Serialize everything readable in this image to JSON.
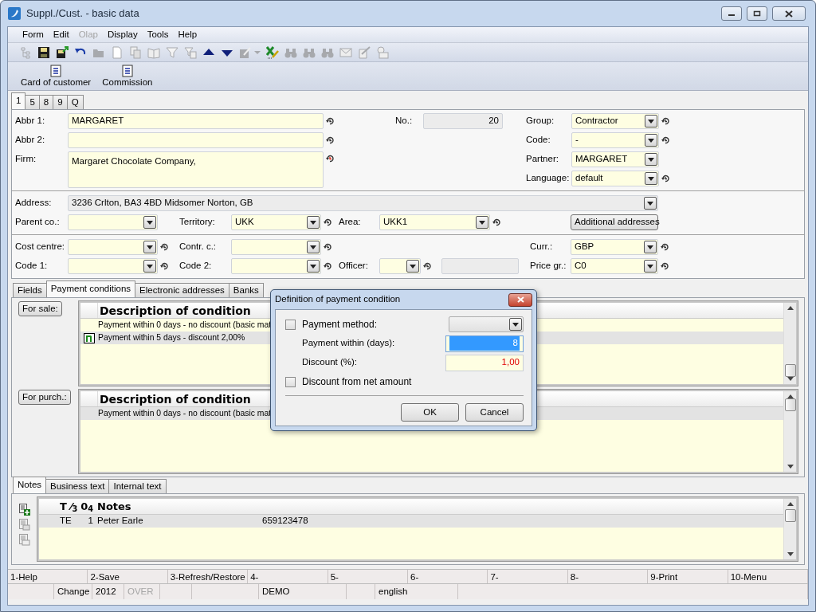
{
  "window": {
    "title": "Suppl./Cust. - basic data"
  },
  "menu": [
    {
      "label": "Form",
      "disabled": false
    },
    {
      "label": "Edit",
      "disabled": false
    },
    {
      "label": "Olap",
      "disabled": true
    },
    {
      "label": "Display",
      "disabled": false
    },
    {
      "label": "Tools",
      "disabled": false
    },
    {
      "label": "Help",
      "disabled": false
    }
  ],
  "toolbar": [
    {
      "kind": "tree",
      "disabled": true
    },
    {
      "kind": "save",
      "disabled": false
    },
    {
      "kind": "saveas",
      "disabled": false
    },
    {
      "kind": "undo",
      "disabled": false
    },
    {
      "kind": "open",
      "disabled": true
    },
    {
      "kind": "new",
      "disabled": true
    },
    {
      "kind": "copy",
      "disabled": true
    },
    {
      "kind": "book",
      "disabled": true
    },
    {
      "kind": "filter",
      "disabled": true
    },
    {
      "kind": "filterlist",
      "disabled": true
    },
    {
      "kind": "up",
      "disabled": false
    },
    {
      "kind": "down",
      "disabled": false
    },
    {
      "kind": "edit",
      "disabled": true
    },
    {
      "kind": "caret",
      "disabled": true
    },
    {
      "kind": "excel",
      "disabled": false
    },
    {
      "kind": "binoculars",
      "disabled": true
    },
    {
      "kind": "binoculars",
      "disabled": true
    },
    {
      "kind": "binoculars",
      "disabled": true
    },
    {
      "kind": "mail",
      "disabled": true
    },
    {
      "kind": "notepad",
      "disabled": true
    },
    {
      "kind": "card",
      "disabled": true
    }
  ],
  "actions": [
    {
      "label": "Card of customer"
    },
    {
      "label": "Commission"
    }
  ],
  "tabs": [
    {
      "label": "1",
      "selected": true
    },
    {
      "label": "5",
      "selected": false
    },
    {
      "label": "8",
      "selected": false
    },
    {
      "label": "9",
      "selected": false
    },
    {
      "label": "Q",
      "selected": false
    }
  ],
  "main_fields": [
    {
      "label": "Abbr 1:",
      "value": "MARGARET",
      "kind": "text",
      "history": true,
      "history_changed": false
    },
    {
      "label": "Abbr 2:",
      "kind": "text",
      "history": true,
      "history_changed": false
    },
    {
      "label": "Firm:",
      "value": "Margaret Chocolate Company,",
      "kind": "memo",
      "history": true,
      "history_changed": true
    },
    {
      "label": "No.:",
      "value": "20",
      "kind": "readonly"
    },
    {
      "label": "Group:",
      "value": "Contractor",
      "kind": "combo",
      "history": true,
      "history_changed": false
    },
    {
      "label": "Code:",
      "value": "-",
      "kind": "combo",
      "history": true,
      "history_changed": false
    },
    {
      "label": "Partner:",
      "value": "MARGARET",
      "kind": "combo"
    },
    {
      "label": "Language:",
      "value": "default",
      "kind": "combo",
      "history": true,
      "history_changed": false
    }
  ],
  "address": {
    "label": "Address:",
    "value": "3236  Crlton, BA3 4BD  Midsomer Norton, GB"
  },
  "address_fields": [
    {
      "label": "Parent co.:",
      "kind": "combo"
    },
    {
      "label": "Territory:",
      "value": "UKK",
      "kind": "combo",
      "history": true,
      "history_changed": false
    },
    {
      "label": "Area:",
      "value": "UKK1",
      "kind": "combo",
      "history": true,
      "history_changed": false
    }
  ],
  "additional_addresses_button": "Additional addresses",
  "other_fields": [
    {
      "label": "Cost centre:",
      "kind": "combo",
      "history": true,
      "history_changed": false
    },
    {
      "label": "Contr. c.:",
      "kind": "combo",
      "history": true,
      "history_changed": false
    },
    {
      "label": "Curr.:",
      "value": "GBP",
      "kind": "combo",
      "history": true,
      "history_changed": false
    },
    {
      "label": "Code 1:",
      "kind": "combo",
      "history": true,
      "history_changed": false
    },
    {
      "label": "Code 2:",
      "kind": "combo",
      "history": true,
      "history_changed": false
    },
    {
      "label": "Officer:",
      "kind": "combo",
      "history": true,
      "history_changed": false,
      "extra_field": true
    },
    {
      "label": "Price gr.:",
      "value": "C0",
      "kind": "combo",
      "history": true,
      "history_changed": false
    }
  ],
  "subtabs": [
    {
      "label": "Fields",
      "selected": false
    },
    {
      "label": "Payment conditions",
      "selected": true
    },
    {
      "label": "Electronic addresses",
      "selected": false
    },
    {
      "label": "Banks",
      "selected": false
    }
  ],
  "condition_tables": [
    {
      "button": "For sale:",
      "column": "Description of condition",
      "rows": [
        {
          "text": "Payment within 0 days - no discount (basic mat",
          "selected": false,
          "current": false
        },
        {
          "text": "Payment within 5 days - discount 2,00%",
          "selected": true,
          "current": true
        }
      ]
    },
    {
      "button": "For purch.:",
      "column": "Description of condition",
      "rows": [
        {
          "text": "Payment within 0 days - no discount (basic mat",
          "selected": true,
          "current": false
        }
      ]
    }
  ],
  "dialog": {
    "title": "Definition of payment condition",
    "rows": [
      {
        "kind": "check_combo",
        "label": "Payment method:",
        "checked": false
      },
      {
        "kind": "input",
        "label": "Payment within (days):",
        "value": "8",
        "focused": true,
        "warning": false
      },
      {
        "kind": "input",
        "label": "Discount (%):",
        "value": "1,00",
        "focused": false,
        "warning": true
      },
      {
        "kind": "check",
        "label": "Discount from net amount",
        "checked": false
      }
    ],
    "buttons": [
      "OK",
      "Cancel"
    ]
  },
  "notes_tabs": [
    {
      "label": "Notes",
      "selected": true
    },
    {
      "label": "Business text",
      "selected": false
    },
    {
      "label": "Internal text",
      "selected": false
    }
  ],
  "notes_table": {
    "columns": [
      "T ⁄$_{3}$",
      "0$_{4}$",
      "Notes"
    ],
    "rows": [
      {
        "type": "TE",
        "number": "1",
        "note": "Peter Earle",
        "column_4": "659123478",
        "selected": true
      }
    ]
  },
  "function_keys": [
    "1-Help",
    "2-Save",
    "3-Refresh/Restore",
    "4-",
    "5-",
    "6-",
    "7-",
    "8-",
    "9-Print",
    "10-Menu"
  ],
  "status_bar": [
    {
      "text": "Change",
      "disabled": false
    },
    {
      "text": "2012",
      "disabled": false
    },
    {
      "text": "OVER",
      "disabled": true
    },
    {
      "text": "DEMO",
      "disabled": false
    },
    {
      "text": "english",
      "disabled": false
    }
  ]
}
